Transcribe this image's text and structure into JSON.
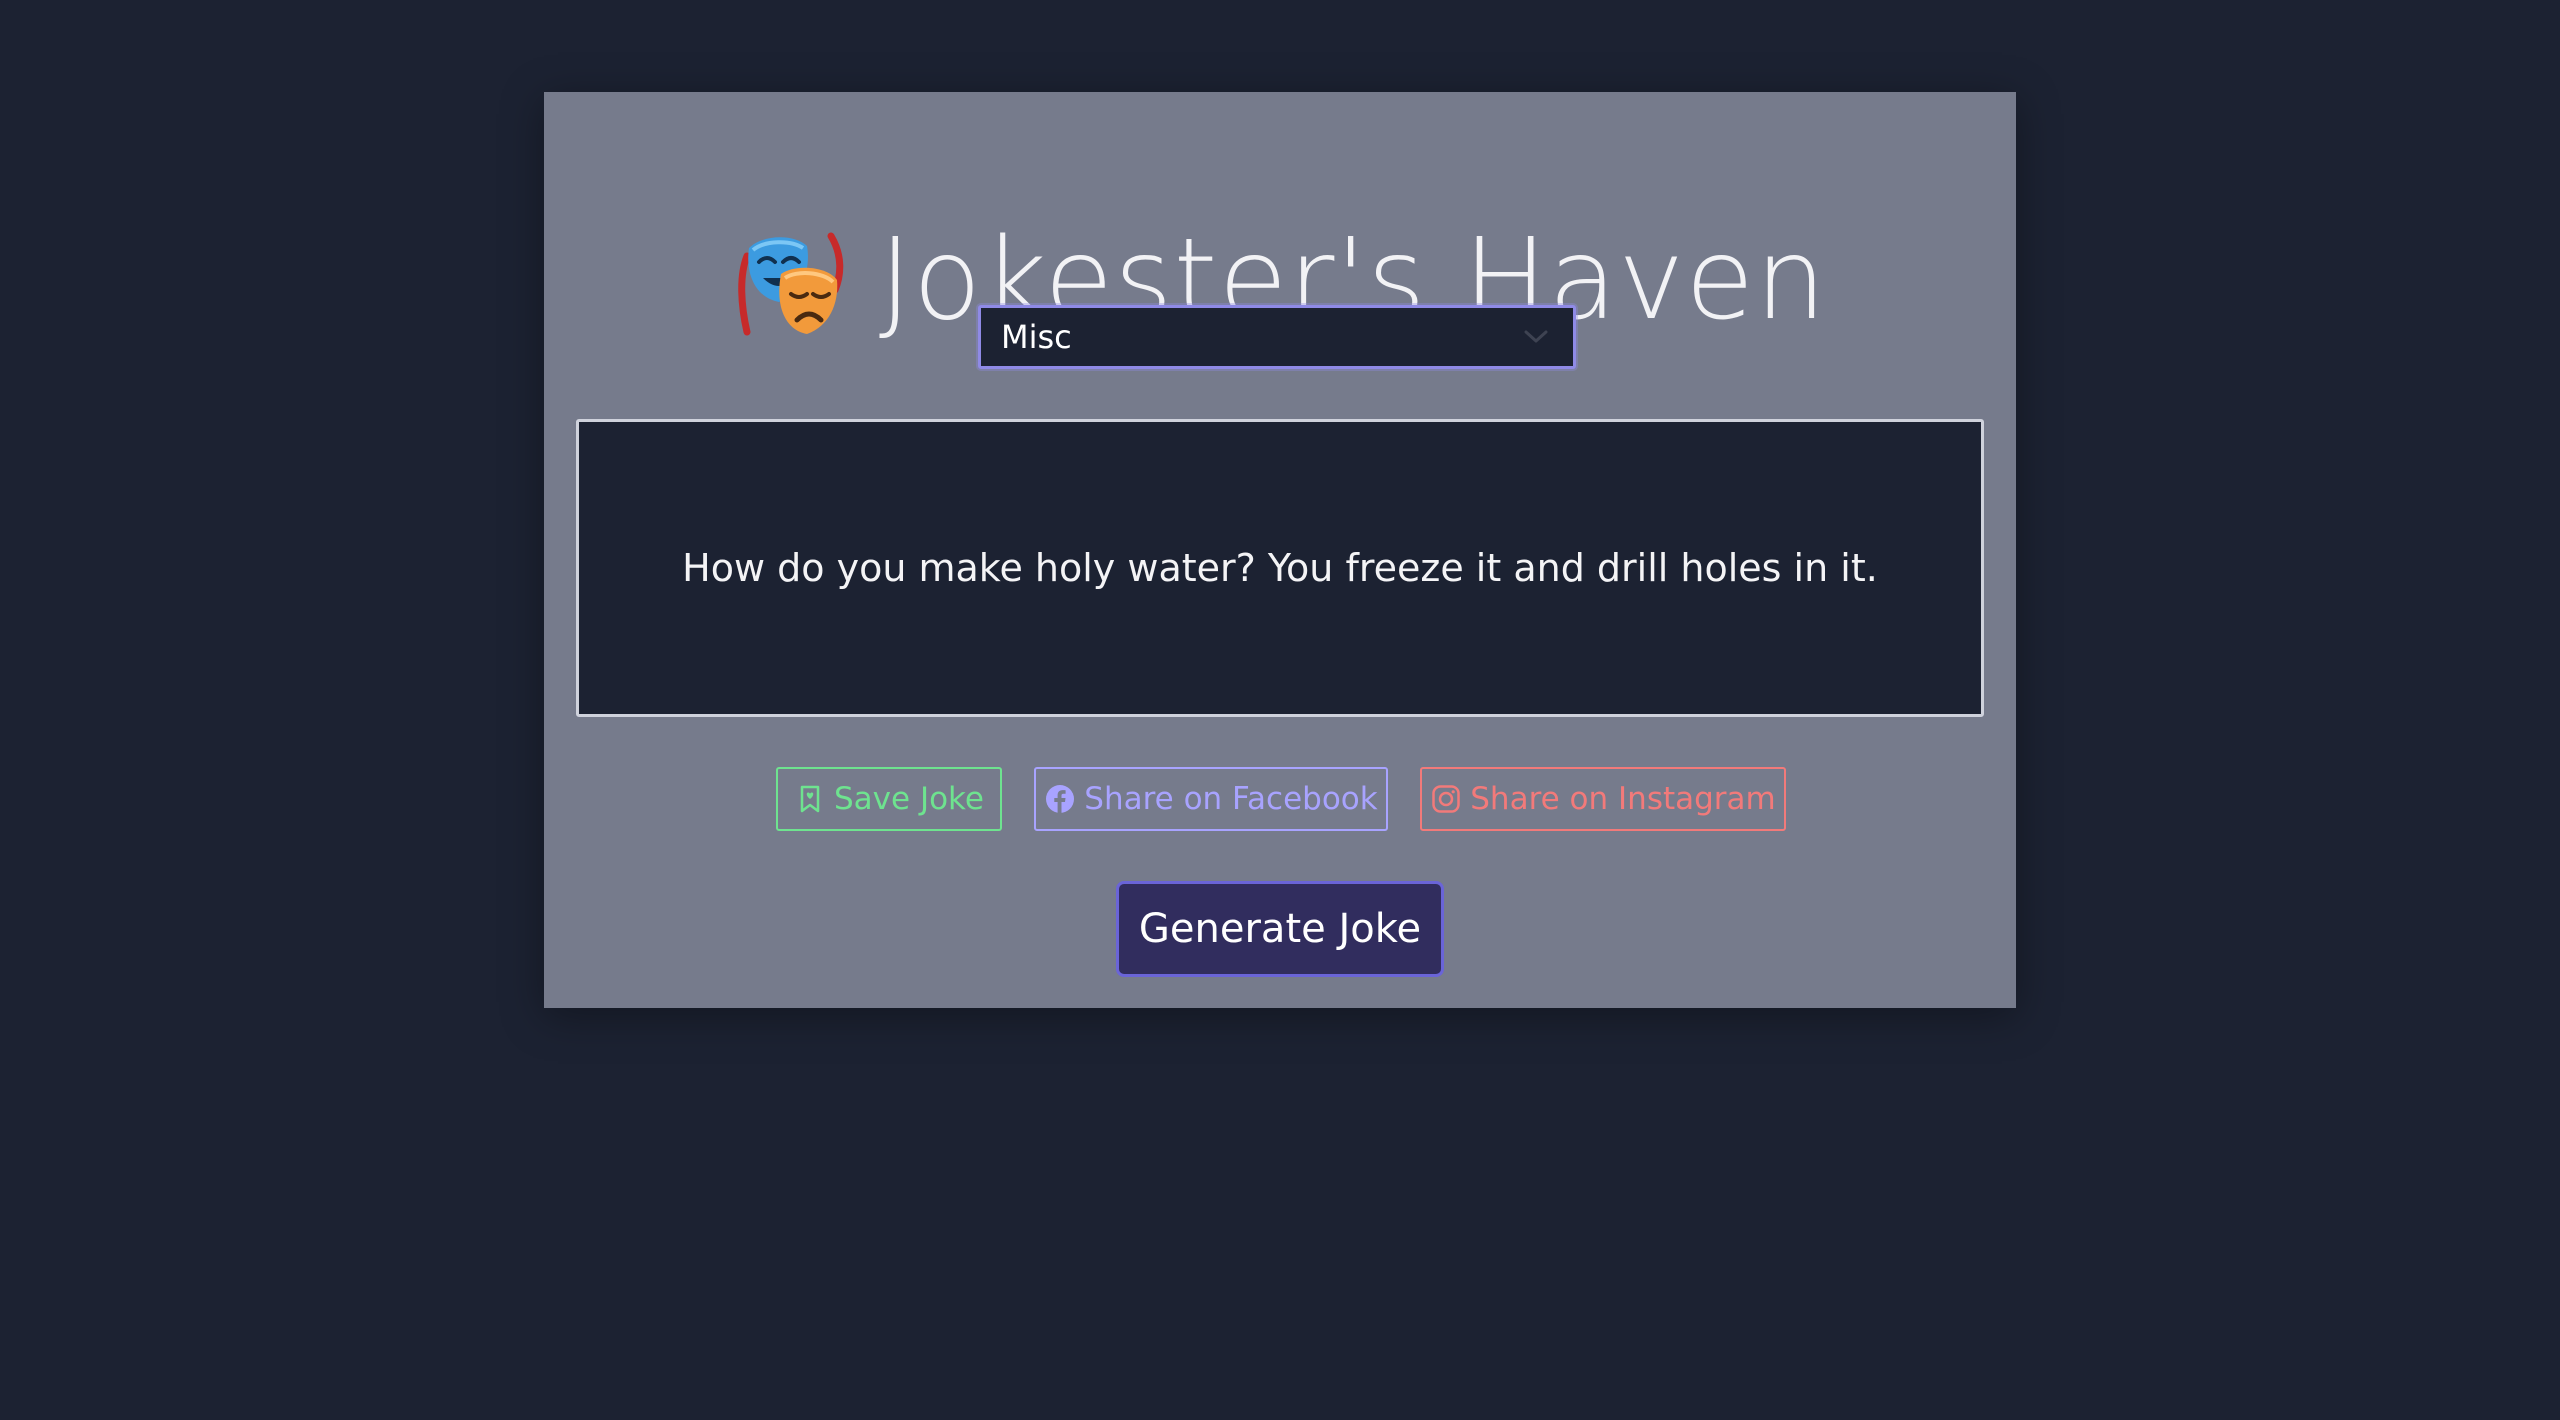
{
  "header": {
    "title": "Jokester's Haven",
    "logo_icon": "performing-arts-masks-icon"
  },
  "category_select": {
    "selected": "Misc"
  },
  "joke": {
    "text": "How do you make holy water? You freeze it and drill holes in it."
  },
  "actions": {
    "save_label": "Save Joke",
    "facebook_label": "Share on Facebook",
    "instagram_label": "Share on Instagram"
  },
  "generate": {
    "label": "Generate Joke"
  },
  "colors": {
    "page_bg": "#1c2232",
    "card_bg": "#767b8c",
    "save": "#6ee38f",
    "facebook": "#a8a3ff",
    "instagram": "#f27a7a",
    "primary": "#312d5e"
  }
}
